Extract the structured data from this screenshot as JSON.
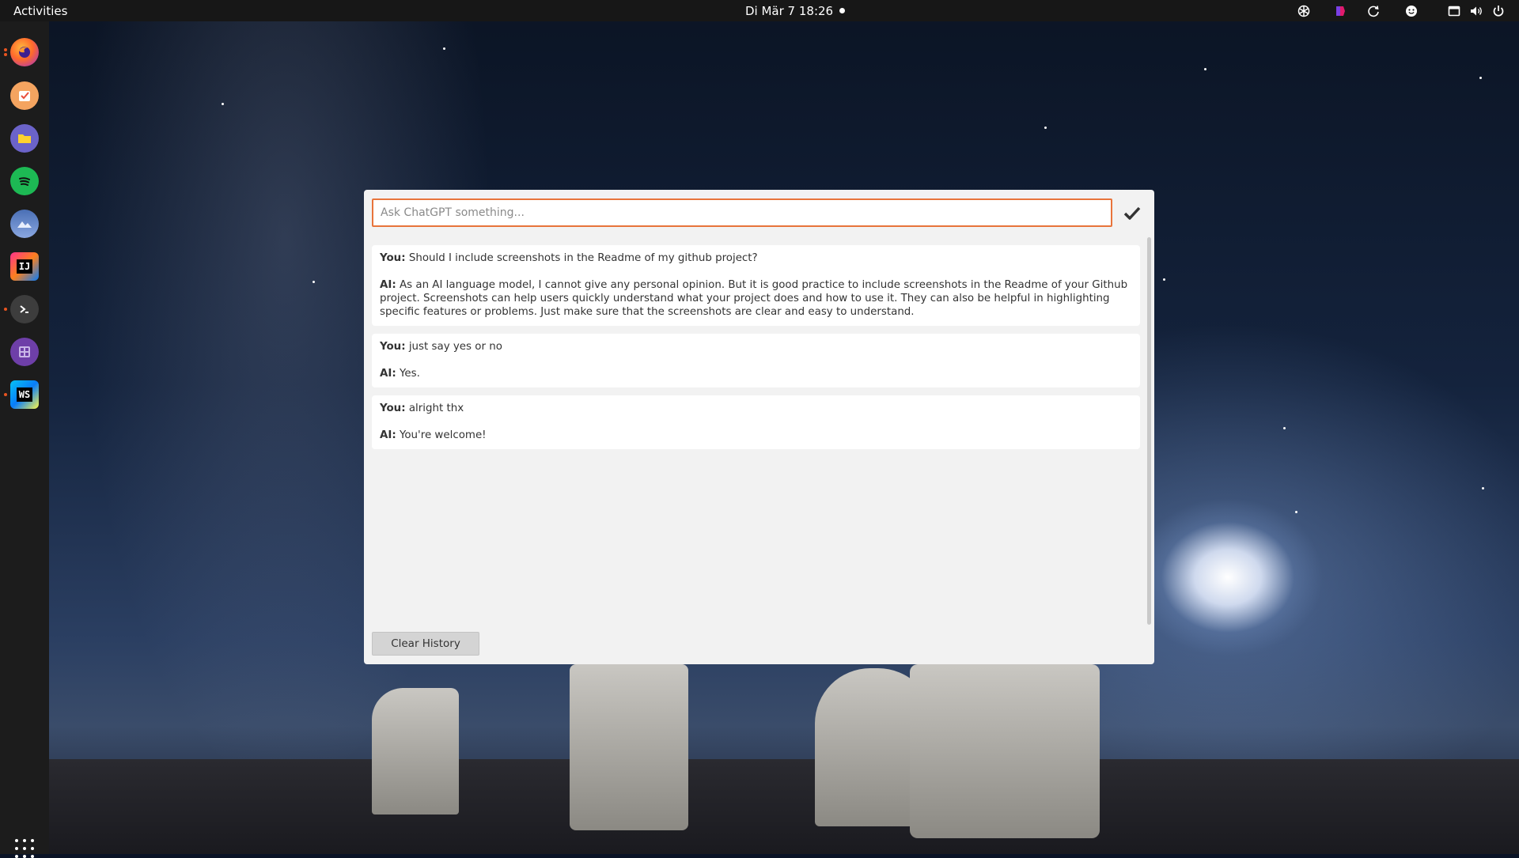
{
  "topbar": {
    "activities_label": "Activities",
    "clock": "Di Mär 7  18:26",
    "tray_icons": [
      "chatgpt-icon",
      "colorpicker-icon",
      "sync-icon",
      "emoji-icon",
      "window-icon",
      "volume-icon",
      "power-icon"
    ]
  },
  "dock": {
    "apps": [
      "firefox-icon",
      "planner-icon",
      "files-icon",
      "spotify-icon",
      "mountain-app-icon",
      "intellij-icon",
      "terminal-icon",
      "calculator-icon",
      "webstorm-icon"
    ],
    "intellij_text": "IJ",
    "webstorm_text": "WS"
  },
  "chat": {
    "input_placeholder": "Ask ChatGPT something...",
    "input_value": "",
    "you_label": "You:",
    "ai_label": "AI:",
    "messages": [
      {
        "you": "Should I include screenshots in the Readme of my github project?",
        "ai": "As an AI language model, I cannot give any personal opinion. But it is good practice to include screenshots in the Readme of your Github project. Screenshots can help users quickly understand what your project does and how to use it. They can also be helpful in highlighting specific features or problems. Just make sure that the screenshots are clear and easy to understand."
      },
      {
        "you": "just say yes or no",
        "ai": "Yes."
      },
      {
        "you": "alright thx",
        "ai": "You're welcome!"
      }
    ],
    "clear_button_label": "Clear History"
  },
  "colors": {
    "accent": "#e8743b",
    "topbar": "#171717",
    "dock": "#1c1c1c"
  }
}
